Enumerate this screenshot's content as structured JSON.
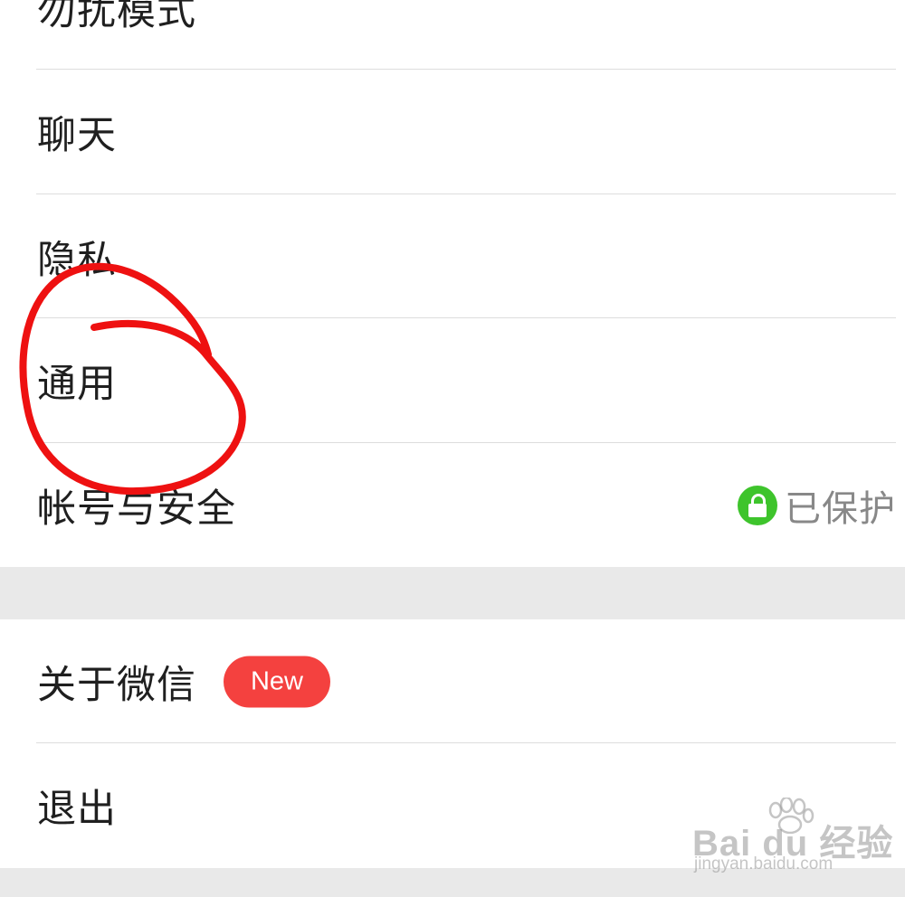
{
  "settings": {
    "group1": [
      {
        "label": "勿扰模式"
      },
      {
        "label": "聊天"
      },
      {
        "label": "隐私"
      },
      {
        "label": "通用"
      },
      {
        "label": "帐号与安全",
        "status": "已保护",
        "status_icon": "lock-icon",
        "status_color": "#3ec42c"
      }
    ],
    "group2": [
      {
        "label": "关于微信",
        "badge": "New",
        "badge_color": "#f4413f"
      },
      {
        "label": "退出"
      }
    ]
  },
  "annotation": {
    "color": "#ee1111",
    "shape": "hand-drawn circle around 通用"
  },
  "watermark": {
    "main": "Bai du 经验",
    "sub": "jingyan.baidu.com"
  }
}
